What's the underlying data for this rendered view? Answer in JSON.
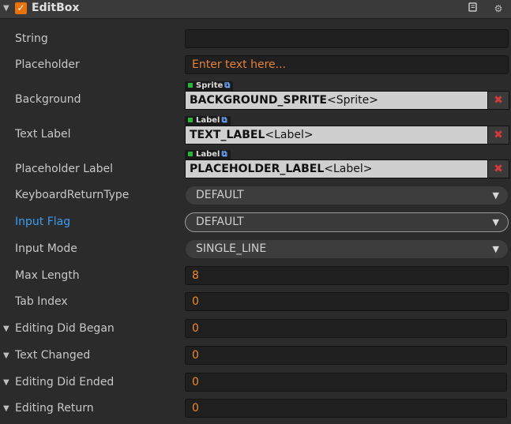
{
  "header": {
    "title": "EditBox",
    "enabled": true,
    "accent": "#e8720c",
    "icons": [
      "book-icon",
      "gear-icon"
    ]
  },
  "props": {
    "string": {
      "label": "String",
      "value": ""
    },
    "placeholder": {
      "label": "Placeholder",
      "value": "Enter text here..."
    },
    "background": {
      "label": "Background",
      "tag": "Sprite",
      "name": "BACKGROUND_SPRITE",
      "type": "<Sprite>"
    },
    "text_label": {
      "label": "Text Label",
      "tag": "Label",
      "name": "TEXT_LABEL",
      "type": "<Label>"
    },
    "placeholder_label": {
      "label": "Placeholder Label",
      "tag": "Label",
      "name": "PLACEHOLDER_LABEL",
      "type": "<Label>"
    },
    "keyboard_return_type": {
      "label": "KeyboardReturnType",
      "value": "DEFAULT"
    },
    "input_flag": {
      "label": "Input Flag",
      "value": "DEFAULT"
    },
    "input_mode": {
      "label": "Input Mode",
      "value": "SINGLE_LINE"
    },
    "max_length": {
      "label": "Max Length",
      "value": "8"
    },
    "tab_index": {
      "label": "Tab Index",
      "value": "0"
    },
    "editing_did_began": {
      "label": "Editing Did Began",
      "value": "0"
    },
    "text_changed": {
      "label": "Text Changed",
      "value": "0"
    },
    "editing_did_ended": {
      "label": "Editing Did Ended",
      "value": "0"
    },
    "editing_return": {
      "label": "Editing Return",
      "value": "0"
    }
  }
}
